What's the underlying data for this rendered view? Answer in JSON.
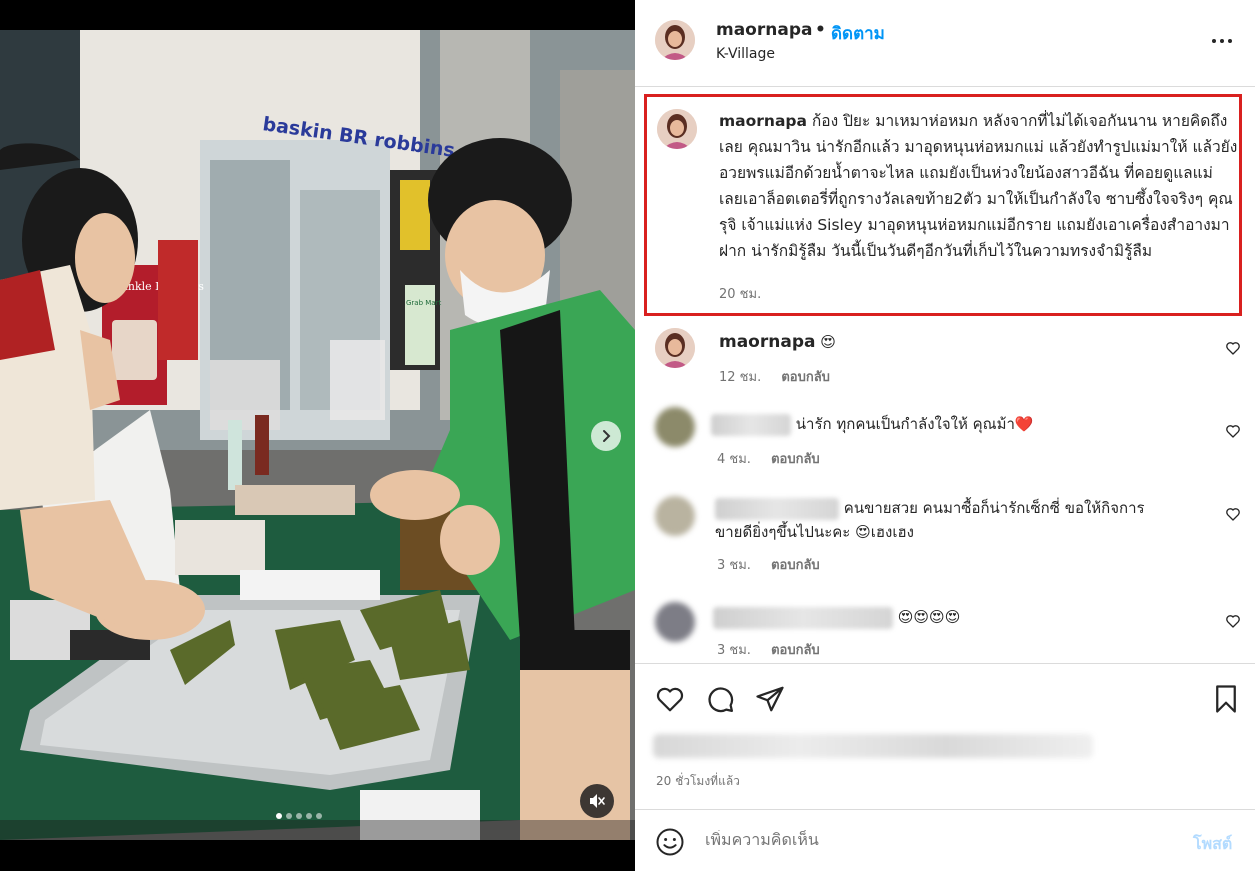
{
  "header": {
    "username": "maornapa",
    "separator": "•",
    "follow_label": "ดิดตาม",
    "location": "K-Village"
  },
  "post": {
    "username": "maornapa",
    "caption": "ก้อง ปิยะ มาเหมาห่อหมก หลังจากที่ไม่ได้เจอกันนาน หายคิดถึงเลย คุณมาวิน น่ารักอีกแล้ว มาอุดหนุนห่อหมกแม่ แล้วยังทำรูปแม่มาให้ แล้วยังอวยพรแม่อีกด้วยน้ำตาจะไหล แถมยังเป็นห่วงใยน้องสาวอีฉัน ที่คอยดูแลแม่ เลยเอาล็อตเตอรี่ที่ถูกรางวัลเลขท้าย2ตัว มาให้เป็นกำลังใจ ซาบซึ้งใจจริงๆ คุณรุจิ เจ้าแม่แห่ง Sisley มาอุดหนุนห่อหมกแม่อีกราย แถมยังเอาเครื่องสำอางมาฝาก น่ารักมิรู้ลืม วันนี้เป็นวันดีๆอีกวันที่เก็บไว้ในความทรงจำมิรู้ลืม",
    "time": "20 ชม."
  },
  "comments": [
    {
      "username": "maornapa",
      "text": "😍",
      "time": "12 ชม.",
      "reply_label": "ตอบกลับ"
    },
    {
      "username": "",
      "text": "น่ารัก ทุกคนเป็นกำลังใจให้ คุณม้า❤️",
      "time": "4 ชม.",
      "reply_label": "ตอบกลับ"
    },
    {
      "username": "",
      "text_line1": "คนขายสวย คนมาซื้อก็น่ารักเซ็กซี่ ขอให้กิจการ",
      "text_line2": "ขายดียิ่งๆขึ้นไปนะคะ 😍เฮงเฮง",
      "time": "3 ชม.",
      "reply_label": "ตอบกลับ"
    },
    {
      "username": "",
      "text": "😍😍😍😍",
      "time": "3 ชม.",
      "reply_label": "ตอบกลับ"
    }
  ],
  "footer": {
    "time_ago": "20 ชั่วโมงที่แล้ว",
    "add_comment_placeholder": "เพิ่มความคิดเห็น",
    "post_label": "โพสต์"
  },
  "media": {
    "store_sign": "baskin BR robbins",
    "poster_text": "Twinkle Holidays",
    "side_sign": "Grab Mart",
    "carousel_count": 5,
    "carousel_active": 1
  },
  "colors": {
    "highlight": "#d9201f",
    "follow": "#0095f6",
    "post_disabled": "#b3dbff",
    "jacket_green": "#3aa655",
    "table_green": "#1e5c3f"
  },
  "icons": [
    "more-icon",
    "heart-icon",
    "comment-icon",
    "share-icon",
    "bookmark-icon",
    "emoji-icon",
    "chevron-right-icon",
    "mute-icon"
  ]
}
